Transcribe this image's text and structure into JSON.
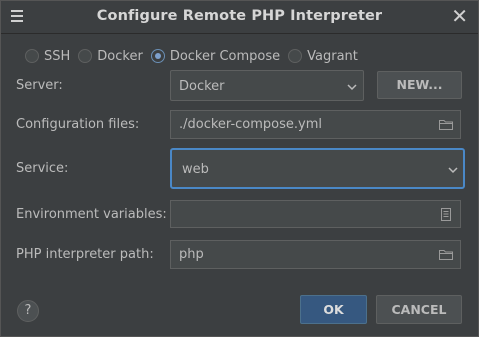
{
  "window": {
    "title": "Configure Remote PHP Interpreter"
  },
  "icons": {
    "menu": "hamburger-menu-icon",
    "close": "close-icon",
    "folder": "folder-icon",
    "env": "document-icon",
    "dropdown": "chevron-down-icon",
    "help": "help-icon"
  },
  "radio_options": [
    {
      "label": "SSH",
      "selected": false
    },
    {
      "label": "Docker",
      "selected": false
    },
    {
      "label": "Docker Compose",
      "selected": true
    },
    {
      "label": "Vagrant",
      "selected": false
    }
  ],
  "server": {
    "label": "Server:",
    "value": "Docker",
    "new_button": "NEW..."
  },
  "config_files": {
    "label": "Configuration files:",
    "value": "./docker-compose.yml"
  },
  "service": {
    "label": "Service:",
    "value": "web"
  },
  "env_vars": {
    "label": "Environment variables:",
    "value": ""
  },
  "php_path": {
    "label": "PHP interpreter path:",
    "value": "php"
  },
  "buttons": {
    "help": "?",
    "ok": "OK",
    "cancel": "CANCEL"
  },
  "colors": {
    "background": "#3c3f41",
    "field": "#45494a",
    "focus": "#4a88c7",
    "primary_button": "#365880",
    "text": "#bbbbbb"
  }
}
